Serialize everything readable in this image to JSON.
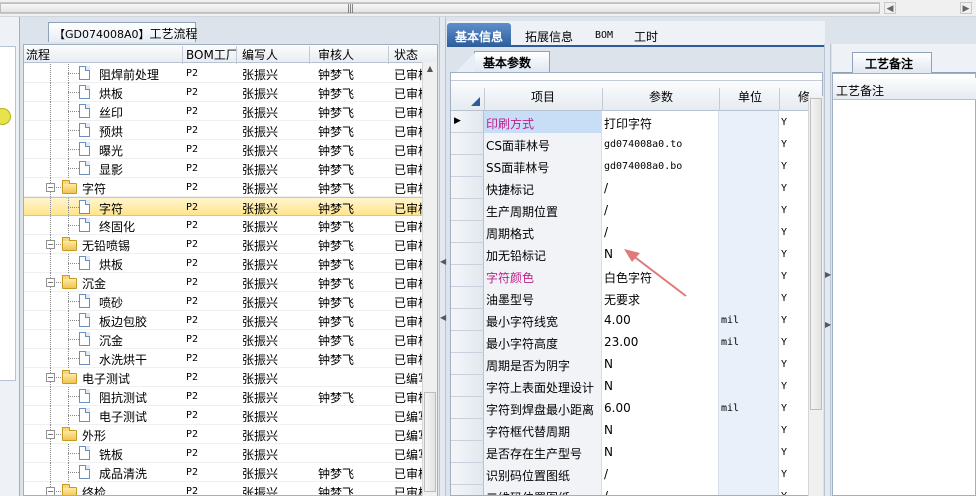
{
  "process_tab": {
    "code": "【GD074008A0】",
    "title": "工艺流程"
  },
  "tree": {
    "columns": [
      "流程",
      "BOM工厂",
      "编写人",
      "审核人",
      "状态"
    ],
    "rows": [
      {
        "name": "阻焊前处理",
        "factory": "P2",
        "writer": "张振兴",
        "reviewer": "钟梦飞",
        "status": "已审核",
        "type": "doc",
        "level": 2
      },
      {
        "name": "烘板",
        "factory": "P2",
        "writer": "张振兴",
        "reviewer": "钟梦飞",
        "status": "已审核",
        "type": "doc",
        "level": 2
      },
      {
        "name": "丝印",
        "factory": "P2",
        "writer": "张振兴",
        "reviewer": "钟梦飞",
        "status": "已审核",
        "type": "doc",
        "level": 2
      },
      {
        "name": "预烘",
        "factory": "P2",
        "writer": "张振兴",
        "reviewer": "钟梦飞",
        "status": "已审核",
        "type": "doc",
        "level": 2
      },
      {
        "name": "曝光",
        "factory": "P2",
        "writer": "张振兴",
        "reviewer": "钟梦飞",
        "status": "已审核",
        "type": "doc",
        "level": 2
      },
      {
        "name": "显影",
        "factory": "P2",
        "writer": "张振兴",
        "reviewer": "钟梦飞",
        "status": "已审核",
        "type": "doc",
        "level": 2
      },
      {
        "name": "字符",
        "factory": "P2",
        "writer": "张振兴",
        "reviewer": "钟梦飞",
        "status": "已审核",
        "type": "folder",
        "level": 1
      },
      {
        "name": "字符",
        "factory": "P2",
        "writer": "张振兴",
        "reviewer": "钟梦飞",
        "status": "已审核",
        "type": "doc",
        "level": 2,
        "selected": true
      },
      {
        "name": "终固化",
        "factory": "P2",
        "writer": "张振兴",
        "reviewer": "钟梦飞",
        "status": "已审核",
        "type": "doc",
        "level": 2
      },
      {
        "name": "无铅喷锡",
        "factory": "P2",
        "writer": "张振兴",
        "reviewer": "钟梦飞",
        "status": "已审核",
        "type": "folder",
        "level": 1
      },
      {
        "name": "烘板",
        "factory": "P2",
        "writer": "张振兴",
        "reviewer": "钟梦飞",
        "status": "已审核",
        "type": "doc",
        "level": 2
      },
      {
        "name": "沉金",
        "factory": "P2",
        "writer": "张振兴",
        "reviewer": "钟梦飞",
        "status": "已审核",
        "type": "folder",
        "level": 1
      },
      {
        "name": "喷砂",
        "factory": "P2",
        "writer": "张振兴",
        "reviewer": "钟梦飞",
        "status": "已审核",
        "type": "doc",
        "level": 2
      },
      {
        "name": "板边包胶",
        "factory": "P2",
        "writer": "张振兴",
        "reviewer": "钟梦飞",
        "status": "已审核",
        "type": "doc",
        "level": 2
      },
      {
        "name": "沉金",
        "factory": "P2",
        "writer": "张振兴",
        "reviewer": "钟梦飞",
        "status": "已审核",
        "type": "doc",
        "level": 2
      },
      {
        "name": "水洗烘干",
        "factory": "P2",
        "writer": "张振兴",
        "reviewer": "钟梦飞",
        "status": "已审核",
        "type": "doc",
        "level": 2
      },
      {
        "name": "电子测试",
        "factory": "P2",
        "writer": "张振兴",
        "reviewer": "",
        "status": "已编写",
        "type": "folder",
        "level": 1
      },
      {
        "name": "阻抗测试",
        "factory": "P2",
        "writer": "张振兴",
        "reviewer": "钟梦飞",
        "status": "已审核",
        "type": "doc",
        "level": 2
      },
      {
        "name": "电子测试",
        "factory": "P2",
        "writer": "张振兴",
        "reviewer": "",
        "status": "已编写",
        "type": "doc",
        "level": 2
      },
      {
        "name": "外形",
        "factory": "P2",
        "writer": "张振兴",
        "reviewer": "",
        "status": "已编写",
        "type": "folder",
        "level": 1
      },
      {
        "name": "铣板",
        "factory": "P2",
        "writer": "张振兴",
        "reviewer": "",
        "status": "已编写",
        "type": "doc",
        "level": 2
      },
      {
        "name": "成品清洗",
        "factory": "P2",
        "writer": "张振兴",
        "reviewer": "钟梦飞",
        "status": "已审核",
        "type": "doc",
        "level": 2
      },
      {
        "name": "终检",
        "factory": "P2",
        "writer": "张振兴",
        "reviewer": "钟梦飞",
        "status": "已审核",
        "type": "folder",
        "level": 1
      }
    ]
  },
  "mid_tabs": [
    {
      "label": "基本信息",
      "active": true
    },
    {
      "label": "拓展信息",
      "active": false
    },
    {
      "label": "BOM",
      "active": false
    },
    {
      "label": "工时",
      "active": false
    }
  ],
  "basic_params_tab": "基本参数",
  "params": {
    "columns": [
      "项目",
      "参数",
      "单位",
      "修"
    ],
    "rows": [
      {
        "item": "印刷方式",
        "value": "打印字符",
        "unit": "",
        "mod": "Y",
        "highlight": true,
        "current": true
      },
      {
        "item": "CS面菲林号",
        "value": "gd074008a0.to",
        "unit": "",
        "mod": "Y",
        "mono": true
      },
      {
        "item": "SS面菲林号",
        "value": "gd074008a0.bo",
        "unit": "",
        "mod": "Y",
        "mono": true
      },
      {
        "item": "快捷标记",
        "value": "/",
        "unit": "",
        "mod": "Y"
      },
      {
        "item": "生产周期位置",
        "value": "/",
        "unit": "",
        "mod": "Y"
      },
      {
        "item": "周期格式",
        "value": "/",
        "unit": "",
        "mod": "Y"
      },
      {
        "item": "加无铅标记",
        "value": "N",
        "unit": "",
        "mod": "Y"
      },
      {
        "item": "字符颜色",
        "value": "白色字符",
        "unit": "",
        "mod": "Y",
        "highlight": true
      },
      {
        "item": "油墨型号",
        "value": "无要求",
        "unit": "",
        "mod": "Y"
      },
      {
        "item": "最小字符线宽",
        "value": "4.00",
        "unit": "mil",
        "mod": "Y"
      },
      {
        "item": "最小字符高度",
        "value": "23.00",
        "unit": "mil",
        "mod": "Y"
      },
      {
        "item": "周期是否为阴字",
        "value": "N",
        "unit": "",
        "mod": "Y"
      },
      {
        "item": "字符上表面处理设计",
        "value": "N",
        "unit": "",
        "mod": "Y"
      },
      {
        "item": "字符到焊盘最小距离",
        "value": "6.00",
        "unit": "mil",
        "mod": "Y"
      },
      {
        "item": "字符框代替周期",
        "value": "N",
        "unit": "",
        "mod": "Y"
      },
      {
        "item": "是否存在生产型号",
        "value": "N",
        "unit": "",
        "mod": "Y"
      },
      {
        "item": "识别码位置图纸",
        "value": "/",
        "unit": "",
        "mod": "Y"
      },
      {
        "item": "二维码位置图纸",
        "value": "/",
        "unit": "",
        "mod": "Y"
      }
    ]
  },
  "notes": {
    "tab": "工艺备注",
    "header": "工艺备注"
  },
  "colors": {
    "accent": "#2c5d9a",
    "highlight_text": "#c0208a",
    "selection": "#ffe58c",
    "arrow": "#e07a7a"
  }
}
